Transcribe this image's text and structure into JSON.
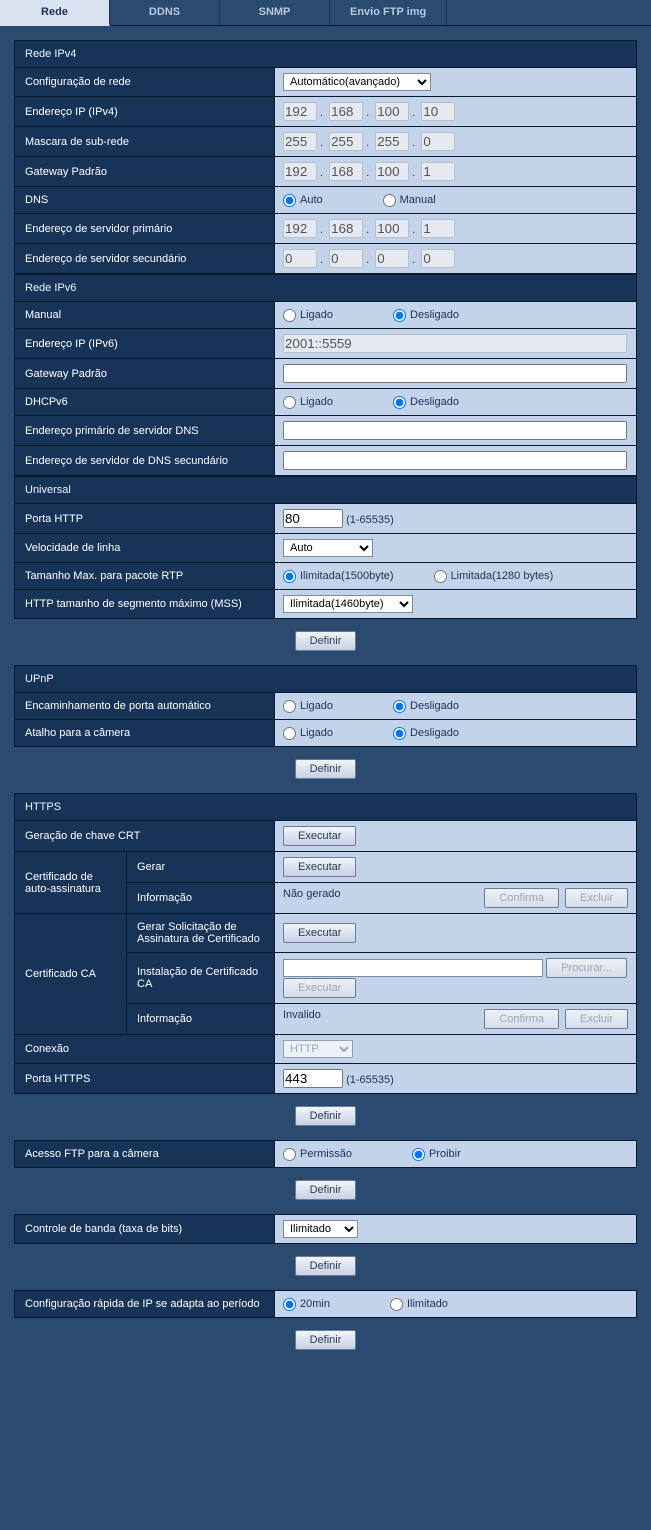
{
  "tabs": {
    "t0": "Rede",
    "t1": "DDNS",
    "t2": "SNMP",
    "t3": "Envio FTP img"
  },
  "ipv4": {
    "header": "Rede IPv4",
    "netconf": {
      "label": "Configuração de rede",
      "value": "Automático(avançado)"
    },
    "ip": {
      "label": "Endereço IP (IPv4)",
      "o1": "192",
      "o2": "168",
      "o3": "100",
      "o4": "10"
    },
    "mask": {
      "label": "Mascara de sub-rede",
      "o1": "255",
      "o2": "255",
      "o3": "255",
      "o4": "0"
    },
    "gw": {
      "label": "Gateway Padrão",
      "o1": "192",
      "o2": "168",
      "o3": "100",
      "o4": "1"
    },
    "dns": {
      "label": "DNS",
      "auto": "Auto",
      "manual": "Manual"
    },
    "dns1": {
      "label": "Endereço de servidor primário",
      "o1": "192",
      "o2": "168",
      "o3": "100",
      "o4": "1"
    },
    "dns2": {
      "label": "Endereço de servidor secundário",
      "o1": "0",
      "o2": "0",
      "o3": "0",
      "o4": "0"
    }
  },
  "ipv6": {
    "header": "Rede IPv6",
    "manual": {
      "label": "Manual",
      "on": "Ligado",
      "off": "Desligado"
    },
    "ip": {
      "label": "Endereço IP (IPv6)",
      "value": "2001::5559"
    },
    "gw": {
      "label": "Gateway Padrão",
      "value": ""
    },
    "dhcp": {
      "label": "DHCPv6",
      "on": "Ligado",
      "off": "Desligado"
    },
    "dns1": {
      "label": "Endereço primário de servidor DNS",
      "value": ""
    },
    "dns2": {
      "label": "Endereço de servidor de DNS secundário",
      "value": ""
    }
  },
  "universal": {
    "header": "Universal",
    "http": {
      "label": "Porta HTTP",
      "value": "80",
      "range": "(1-65535)"
    },
    "speed": {
      "label": "Velocidade de linha",
      "value": "Auto"
    },
    "rtp": {
      "label": "Tamanho Max. para pacote RTP",
      "a": "Ilimitada(1500byte)",
      "b": "Limitada(1280 bytes)"
    },
    "mss": {
      "label": "HTTP tamanho de segmento máximo (MSS)",
      "value": "Ilimitada(1460byte)"
    }
  },
  "upnp": {
    "header": "UPnP",
    "fwd": {
      "label": "Encaminhamento de porta automático",
      "on": "Ligado",
      "off": "Desligado"
    },
    "shortcut": {
      "label": "Atalho para a câmera",
      "on": "Ligado",
      "off": "Desligado"
    }
  },
  "https": {
    "header": "HTTPS",
    "crt": {
      "label": "Geração de chave CRT"
    },
    "selfcert": {
      "label": "Certificado de auto-assinatura",
      "gen": "Gerar",
      "info": "Informação",
      "infoval": "Não gerado"
    },
    "ca": {
      "label": "Certificado CA",
      "csr": "Gerar Solicitação de Assinatura de Certificado",
      "install": "Instalação de Certificado CA",
      "info": "Informação",
      "infoval": "Invalido"
    },
    "conn": {
      "label": "Conexão",
      "value": "HTTP"
    },
    "port": {
      "label": "Porta HTTPS",
      "value": "443",
      "range": "(1-65535)"
    }
  },
  "ftp": {
    "label": "Acesso FTP para a câmera",
    "allow": "Permissão",
    "deny": "Proibir"
  },
  "bw": {
    "label": "Controle de banda (taxa de bits)",
    "value": "Ilimitado"
  },
  "fastip": {
    "label": "Configuração rápida de IP se adapta ao período",
    "a": "20min",
    "b": "Ilimitado"
  },
  "btn": {
    "set": "Definir",
    "exec": "Executar",
    "confirm": "Confirma",
    "delete": "Excluir",
    "browse": "Procurar..."
  }
}
